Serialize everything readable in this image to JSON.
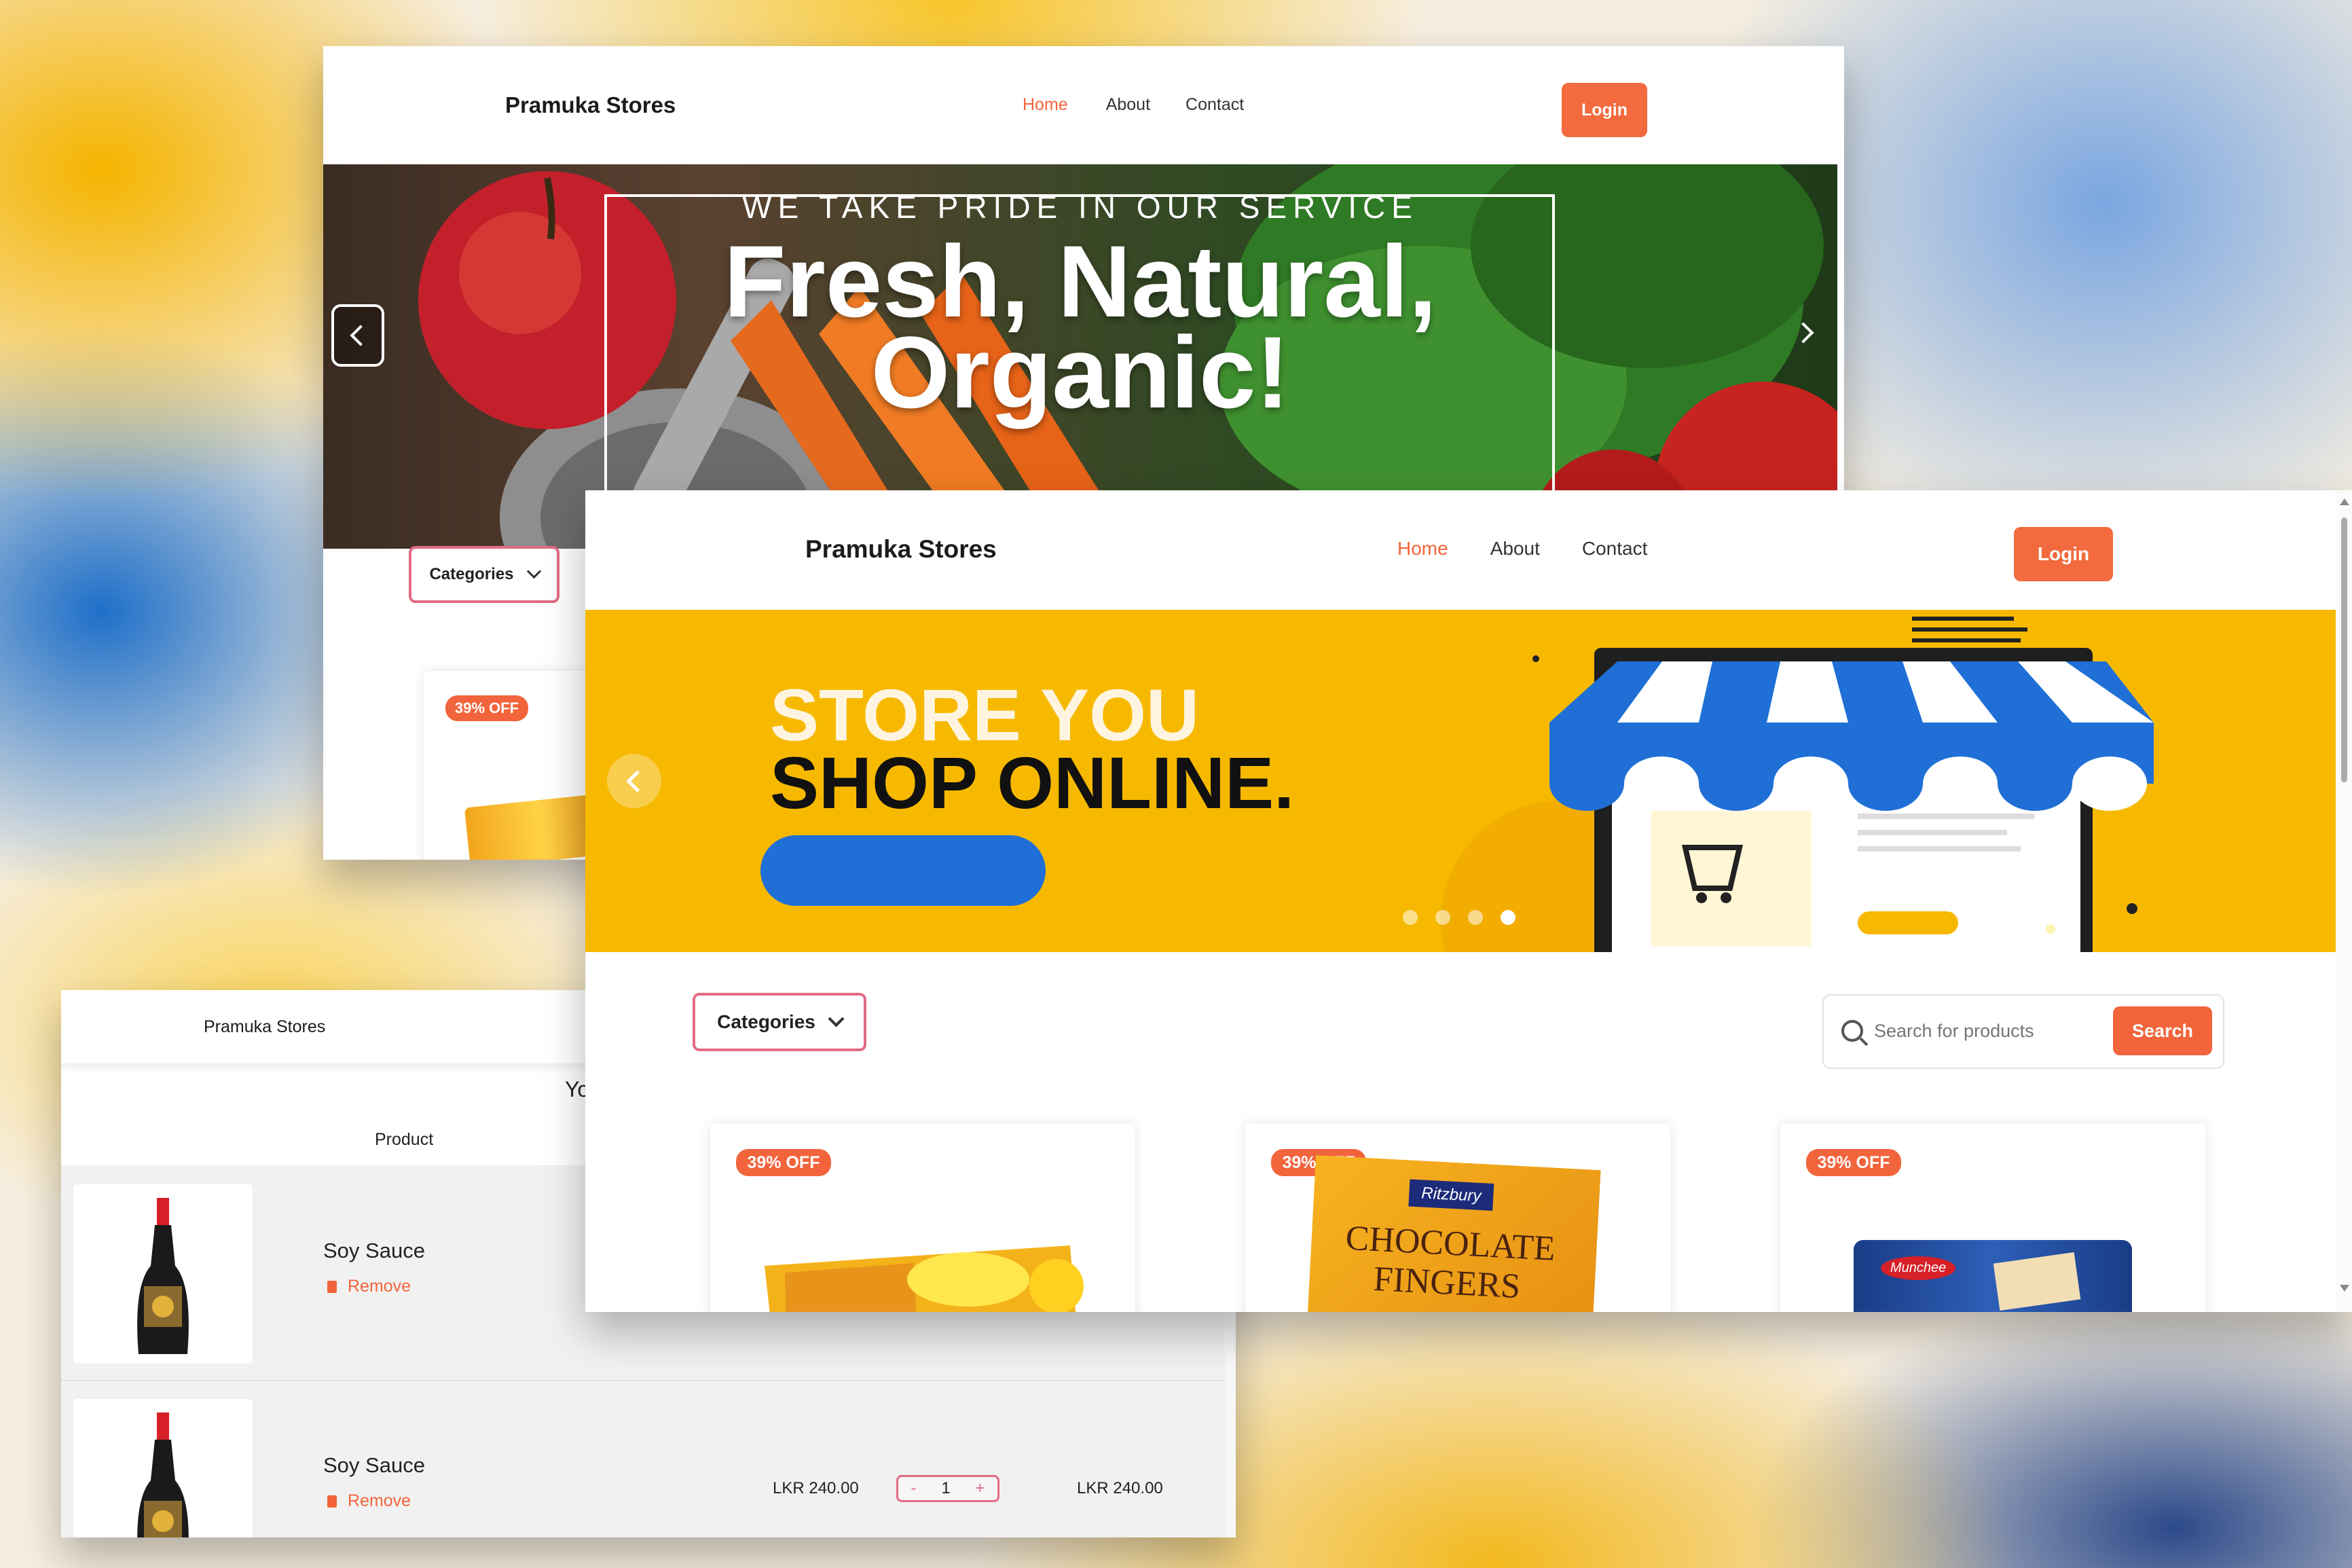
{
  "window_top": {
    "brand": "Pramuka Stores",
    "nav": [
      "Home",
      "About",
      "Contact"
    ],
    "login_label": "Login",
    "hero": {
      "tagline": "WE TAKE PRIDE IN OUR SERVICE",
      "headline_line1": "Fresh, Natural,",
      "headline_line2": "Organic!",
      "slide_count": 4,
      "active_slide": 1
    },
    "categories_label": "Categories",
    "badge": "39% OFF"
  },
  "window_cart": {
    "brand": "Pramuka Stores",
    "heading_partial": "Yo",
    "column_product": "Product",
    "items": [
      {
        "name": "Soy Sauce",
        "remove_label": "Remove"
      },
      {
        "name": "Soy Sauce",
        "remove_label": "Remove",
        "price": "LKR 240.00",
        "qty": "1",
        "minus": "-",
        "plus": "+",
        "total": "LKR 240.00"
      }
    ]
  },
  "window_main": {
    "brand": "Pramuka Stores",
    "nav": [
      "Home",
      "About",
      "Contact"
    ],
    "login_label": "Login",
    "hero": {
      "line1": "STORE YOU",
      "line2": "SHOP ONLINE.",
      "slide_count": 4,
      "active_slide": 4
    },
    "categories_label": "Categories",
    "search": {
      "placeholder": "Search for products",
      "button_label": "Search"
    },
    "products": [
      {
        "badge": "39% OFF",
        "image": "lemon-puff-biscuits"
      },
      {
        "badge": "39% OFF",
        "image": "chocolate-fingers-box",
        "box_brand": "Ritzbury",
        "box_text_line1": "CHOCOLATE",
        "box_text_line2": "FINGERS"
      },
      {
        "badge": "39% OFF",
        "image": "vanilla-wafer-pack",
        "box_brand": "Munchee"
      }
    ]
  },
  "colors": {
    "accent": "#f2643b",
    "category_border": "#e26b86",
    "hero_yellow": "#f7b900",
    "awning_blue": "#1f6fd6"
  }
}
